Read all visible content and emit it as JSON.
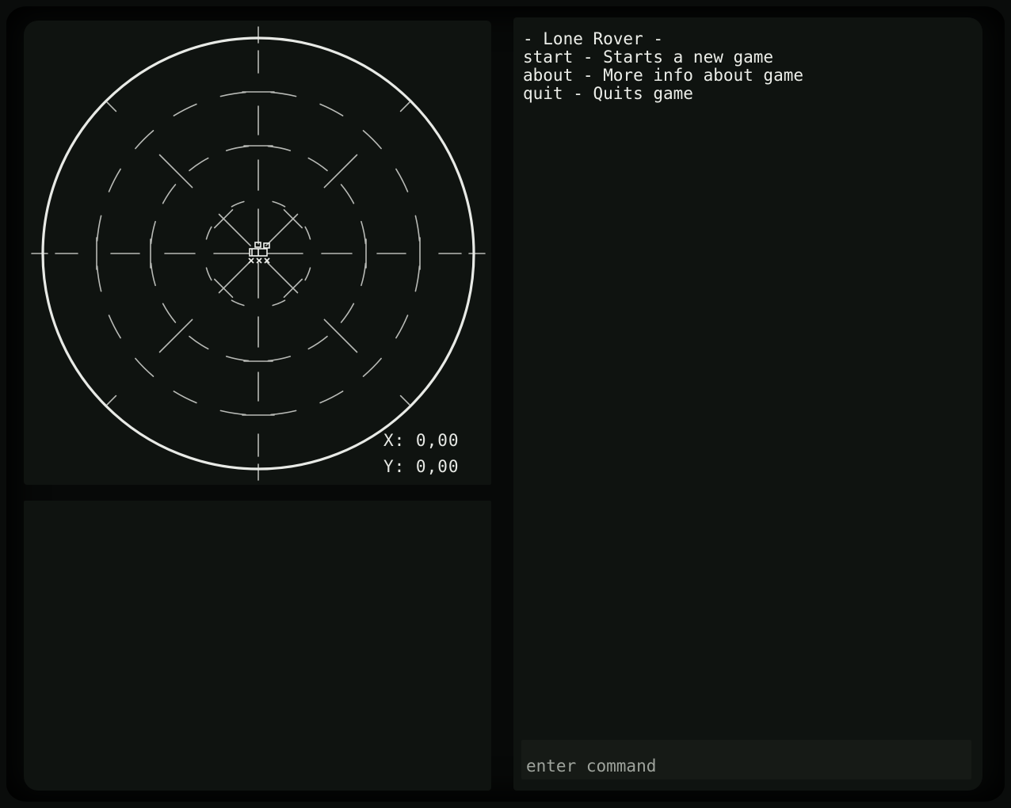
{
  "game": {
    "title": "Lone Rover"
  },
  "radar": {
    "player_icon": "rover-icon",
    "x_readout": "X: 0,00",
    "y_readout": "Y: 0,00"
  },
  "console": {
    "lines": [
      "- Lone Rover -",
      "start - Starts a new game",
      "about - More info about game",
      "quit - Quits game"
    ],
    "input_value": "",
    "input_placeholder": "enter command"
  },
  "colors": {
    "background": "#0a0c0b",
    "panel": "#0f1310",
    "phosphor_text": "#e4e6e2",
    "radar_lines": "#b8bab6",
    "radar_ring": "#e8eae6",
    "input_background": "#161a16",
    "placeholder_text": "#9ea39c"
  }
}
